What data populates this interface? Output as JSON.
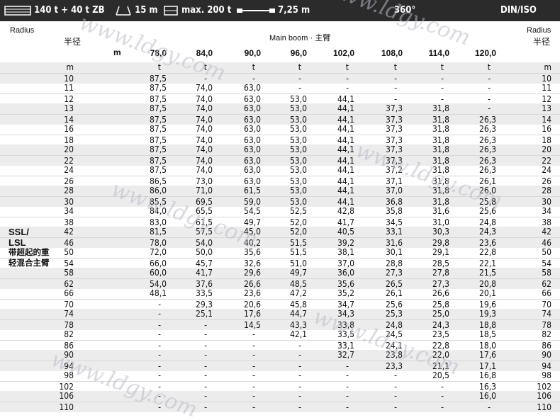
{
  "topbar": {
    "counterweight": "140 t + 40 t ZB",
    "radius": "15 m",
    "capacity": "max. 200 t",
    "width": "7,25 m",
    "slew": "360°",
    "standard": "DIN/ISO"
  },
  "header": {
    "radius_left_en": "Radius",
    "radius_left_cn": "半径",
    "radius_right_en": "Radius",
    "radius_right_cn": "半径",
    "boom_label": "Main boom · 主臂",
    "m_label": "m",
    "columns": [
      "78,0",
      "84,0",
      "90,0",
      "96,0",
      "102,0",
      "108,0",
      "114,0",
      "120,0"
    ],
    "units": [
      "t",
      "t",
      "t",
      "t",
      "t",
      "t",
      "t",
      "t"
    ],
    "unit_row_radius": "m"
  },
  "side_label": {
    "en_line1": "SSL/",
    "en_line2": "LSL",
    "cn_line1": "带超起的重",
    "cn_line2": "轻混合主臂"
  },
  "rows": [
    {
      "r": "10",
      "v": [
        "87,5",
        "-",
        "-",
        "-",
        "-",
        "-",
        "-",
        "-"
      ]
    },
    {
      "r": "11",
      "v": [
        "87,5",
        "74,0",
        "63,0",
        "-",
        "-",
        "-",
        "-",
        "-"
      ]
    },
    {
      "r": "12",
      "v": [
        "87,5",
        "74,0",
        "63,0",
        "53,0",
        "44,1",
        "-",
        "-",
        "-"
      ]
    },
    {
      "r": "13",
      "v": [
        "87,5",
        "74,0",
        "63,0",
        "53,0",
        "44,1",
        "37,3",
        "31,8",
        "-"
      ]
    },
    {
      "r": "14",
      "v": [
        "87,5",
        "74,0",
        "63,0",
        "53,0",
        "44,1",
        "37,3",
        "31,8",
        "26,3"
      ]
    },
    {
      "r": "16",
      "v": [
        "87,5",
        "74,0",
        "63,0",
        "53,0",
        "44,1",
        "37,3",
        "31,8",
        "26,3"
      ]
    },
    {
      "r": "18",
      "v": [
        "87,5",
        "74,0",
        "63,0",
        "53,0",
        "44,1",
        "37,3",
        "31,8",
        "26,3"
      ]
    },
    {
      "r": "20",
      "v": [
        "87,5",
        "74,0",
        "63,0",
        "53,0",
        "44,1",
        "37,3",
        "31,8",
        "26,3"
      ]
    },
    {
      "r": "22",
      "v": [
        "87,5",
        "74,0",
        "63,0",
        "53,0",
        "44,1",
        "37,3",
        "31,8",
        "26,3"
      ]
    },
    {
      "r": "24",
      "v": [
        "87,5",
        "74,0",
        "63,0",
        "53,0",
        "44,1",
        "37,2",
        "31,8",
        "26,3"
      ]
    },
    {
      "r": "26",
      "v": [
        "86,5",
        "73,0",
        "63,0",
        "53,0",
        "44,1",
        "37,1",
        "31,8",
        "26,1"
      ]
    },
    {
      "r": "28",
      "v": [
        "86,0",
        "71,0",
        "61,5",
        "53,0",
        "44,1",
        "37,0",
        "31,8",
        "26,0"
      ]
    },
    {
      "r": "30",
      "v": [
        "85,5",
        "69,5",
        "59,0",
        "53,0",
        "44,1",
        "36,8",
        "31,8",
        "25,8"
      ]
    },
    {
      "r": "34",
      "v": [
        "84,0",
        "65,5",
        "54,5",
        "52,5",
        "42,8",
        "35,8",
        "31,6",
        "25,6"
      ]
    },
    {
      "r": "38",
      "v": [
        "83,0",
        "61,5",
        "49,7",
        "52,0",
        "41,7",
        "34,5",
        "31,0",
        "24,8"
      ]
    },
    {
      "r": "42",
      "v": [
        "81,5",
        "57,5",
        "45,0",
        "52,0",
        "40,5",
        "33,1",
        "30,3",
        "24,3"
      ]
    },
    {
      "r": "46",
      "v": [
        "78,0",
        "54,0",
        "40,2",
        "51,5",
        "39,2",
        "31,6",
        "29,8",
        "23,6"
      ]
    },
    {
      "r": "50",
      "v": [
        "72,0",
        "50,0",
        "35,6",
        "51,5",
        "38,1",
        "30,1",
        "29,1",
        "22,8"
      ]
    },
    {
      "r": "54",
      "v": [
        "66,0",
        "45,7",
        "32,6",
        "51,0",
        "37,0",
        "28,8",
        "28,5",
        "22,1"
      ]
    },
    {
      "r": "58",
      "v": [
        "60,0",
        "41,7",
        "29,6",
        "49,7",
        "36,0",
        "27,3",
        "27,8",
        "21,5"
      ]
    },
    {
      "r": "62",
      "v": [
        "54,0",
        "37,6",
        "26,6",
        "48,5",
        "35,6",
        "26,5",
        "27,3",
        "20,8"
      ]
    },
    {
      "r": "66",
      "v": [
        "48,1",
        "33,5",
        "23,6",
        "47,2",
        "35,2",
        "26,1",
        "26,6",
        "20,1"
      ]
    },
    {
      "r": "70",
      "v": [
        "-",
        "29,3",
        "20,6",
        "45,8",
        "34,7",
        "25,6",
        "25,8",
        "19,6"
      ]
    },
    {
      "r": "74",
      "v": [
        "-",
        "25,1",
        "17,6",
        "44,7",
        "34,3",
        "25,3",
        "25,0",
        "19,3"
      ]
    },
    {
      "r": "78",
      "v": [
        "-",
        "-",
        "14,5",
        "43,3",
        "33,8",
        "24,8",
        "24,3",
        "18,8"
      ]
    },
    {
      "r": "82",
      "v": [
        "-",
        "-",
        "-",
        "42,1",
        "33,5",
        "24,5",
        "23,5",
        "18,5"
      ]
    },
    {
      "r": "86",
      "v": [
        "-",
        "-",
        "-",
        "-",
        "33,1",
        "24,1",
        "22,8",
        "18,0"
      ]
    },
    {
      "r": "90",
      "v": [
        "-",
        "-",
        "-",
        "-",
        "32,7",
        "23,8",
        "22,0",
        "17,6"
      ]
    },
    {
      "r": "94",
      "v": [
        "-",
        "-",
        "-",
        "-",
        "-",
        "23,3",
        "21,1",
        "17,1"
      ]
    },
    {
      "r": "98",
      "v": [
        "-",
        "-",
        "-",
        "-",
        "-",
        "-",
        "20,5",
        "16,8"
      ]
    },
    {
      "r": "102",
      "v": [
        "-",
        "-",
        "-",
        "-",
        "-",
        "-",
        "-",
        "16,3"
      ]
    },
    {
      "r": "106",
      "v": [
        "-",
        "-",
        "-",
        "-",
        "-",
        "-",
        "-",
        "16,0"
      ]
    },
    {
      "r": "110",
      "v": [
        "-",
        "-",
        "-",
        "-",
        "-",
        "-",
        "-",
        "-"
      ]
    }
  ],
  "watermark": "www.ldgy.com",
  "colors": {
    "topbar": "#2b2b2b",
    "shade": "#ececec",
    "watermark": "#b9b9c8"
  }
}
